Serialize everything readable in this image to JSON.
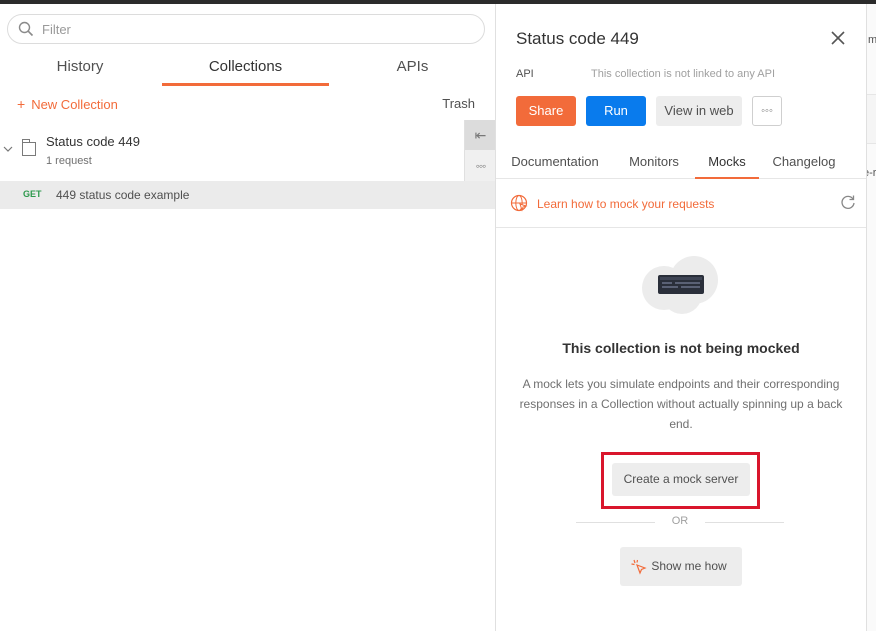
{
  "sidebar": {
    "filter_placeholder": "Filter",
    "tabs": [
      {
        "label": "History"
      },
      {
        "label": "Collections"
      },
      {
        "label": "APIs"
      }
    ],
    "new_collection_label": "New Collection",
    "trash_label": "Trash",
    "collection": {
      "name": "Status code 449",
      "count": "1 request"
    },
    "request": {
      "method": "GET",
      "name": "449 status code example"
    }
  },
  "panel": {
    "title": "Status code 449",
    "api_label": "API",
    "api_status": "This collection is not linked to any API",
    "buttons": {
      "share": "Share",
      "run": "Run",
      "view_in_web": "View in web",
      "more": "◦◦◦"
    },
    "tabs": [
      {
        "label": "Documentation"
      },
      {
        "label": "Monitors"
      },
      {
        "label": "Mocks"
      },
      {
        "label": "Changelog"
      }
    ],
    "learn_link": "Learn how to mock your requests",
    "empty_title": "This collection is not being mocked",
    "empty_description": "A mock lets you simulate endpoints and their corresponding responses in a Collection without actually spinning up a back end.",
    "create_button": "Create a mock server",
    "or_text": "OR",
    "show_button": "Show me how"
  },
  "strip": {
    "frag1": "m",
    "frag2": "e-r"
  },
  "colors": {
    "accent": "#f26b3a",
    "run_blue": "#097bed",
    "highlight_red": "#d9162c",
    "get_green": "#2e9a4d"
  }
}
